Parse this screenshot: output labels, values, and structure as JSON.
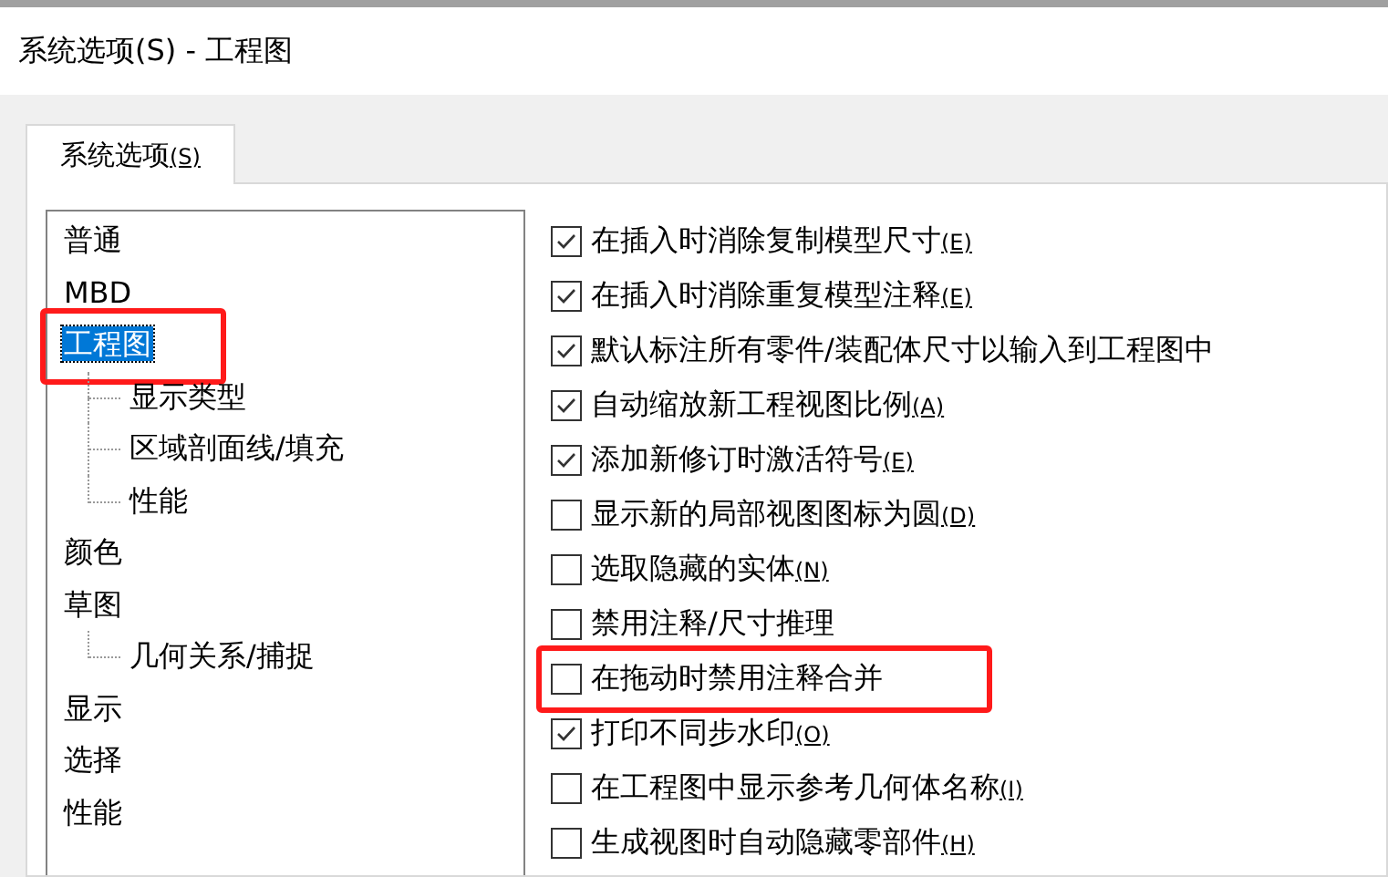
{
  "window": {
    "title": "系统选项(S) - 工程图"
  },
  "tabs": [
    {
      "label": "系统选项",
      "mnemonic": "(S)",
      "selected": true
    }
  ],
  "tree": {
    "items": [
      {
        "label": "普通",
        "selected": false,
        "annotated": false
      },
      {
        "label": "MBD",
        "selected": false,
        "annotated": false
      },
      {
        "label": "工程图",
        "selected": true,
        "annotated": true,
        "children": [
          {
            "label": "显示类型",
            "selected": false,
            "annotated": false
          },
          {
            "label": "区域剖面线/填充",
            "selected": false,
            "annotated": false
          },
          {
            "label": "性能",
            "selected": false,
            "annotated": false
          }
        ]
      },
      {
        "label": "颜色",
        "selected": false,
        "annotated": false
      },
      {
        "label": "草图",
        "selected": false,
        "annotated": false,
        "children": [
          {
            "label": "几何关系/捕捉",
            "selected": false,
            "annotated": false
          }
        ]
      },
      {
        "label": "显示",
        "selected": false,
        "annotated": false
      },
      {
        "label": "选择",
        "selected": false,
        "annotated": false
      },
      {
        "label": "性能",
        "selected": false,
        "annotated": false
      }
    ]
  },
  "options": [
    {
      "label": "在插入时消除复制模型尺寸",
      "mnemonic": "(E)",
      "checked": true,
      "annotated": false
    },
    {
      "label": "在插入时消除重复模型注释",
      "mnemonic": "(E)",
      "checked": true,
      "annotated": false
    },
    {
      "label": "默认标注所有零件/装配体尺寸以输入到工程图中",
      "checked": true,
      "annotated": false
    },
    {
      "label": "自动缩放新工程视图比例",
      "mnemonic": "(A)",
      "checked": true,
      "annotated": false
    },
    {
      "label": "添加新修订时激活符号",
      "mnemonic": "(E)",
      "checked": true,
      "annotated": false
    },
    {
      "label": "显示新的局部视图图标为圆",
      "mnemonic": "(D)",
      "checked": false,
      "annotated": false
    },
    {
      "label": "选取隐藏的实体",
      "mnemonic": "(N)",
      "checked": false,
      "annotated": false
    },
    {
      "label": "禁用注释/尺寸推理",
      "checked": false,
      "annotated": false
    },
    {
      "label": "在拖动时禁用注释合并",
      "checked": false,
      "annotated": true
    },
    {
      "label": "打印不同步水印",
      "mnemonic": "(O)",
      "checked": true,
      "annotated": false
    },
    {
      "label": "在工程图中显示参考几何体名称",
      "mnemonic": "(I)",
      "checked": false,
      "annotated": false
    },
    {
      "label": "生成视图时自动隐藏零部件",
      "mnemonic": "(H)",
      "checked": false,
      "annotated": false
    }
  ]
}
